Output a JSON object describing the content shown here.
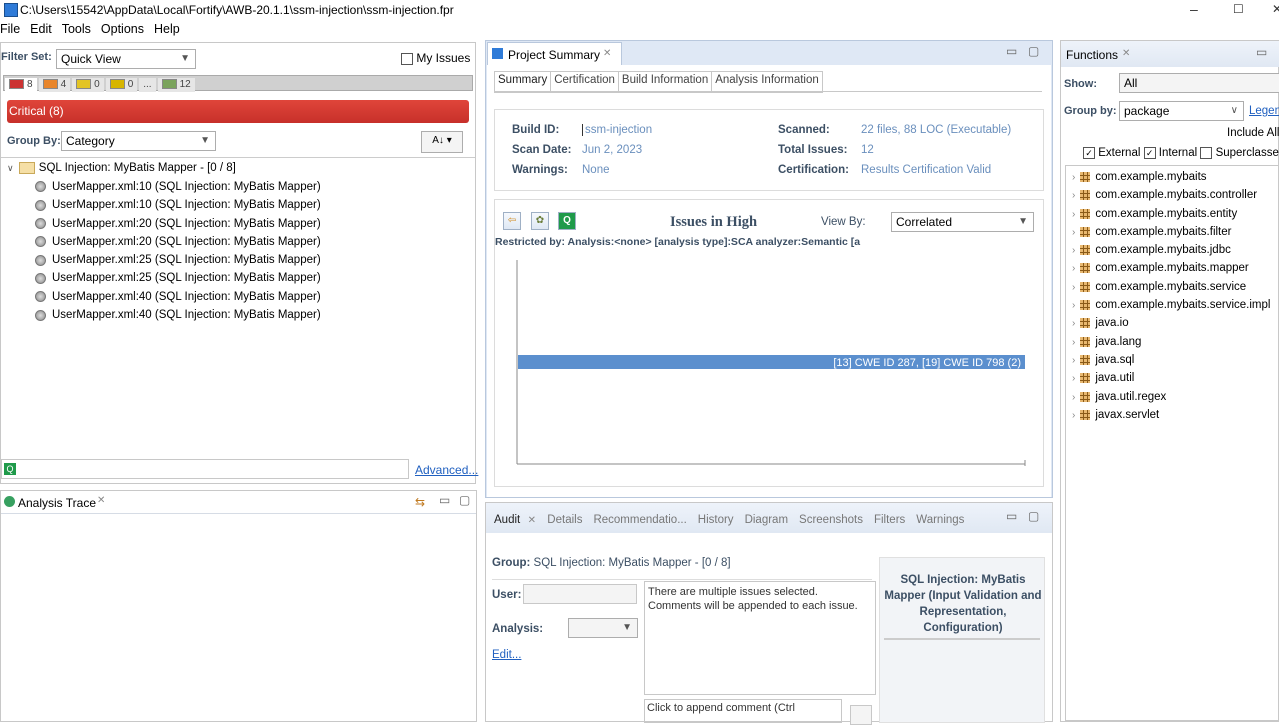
{
  "window": {
    "title": "C:\\Users\\15542\\AppData\\Local\\Fortify\\AWB-20.1.1\\ssm-injection\\ssm-injection.fpr",
    "minimize": "–",
    "maximize": "☐",
    "close": "✕"
  },
  "menu": [
    "File",
    "Edit",
    "Tools",
    "Options",
    "Help"
  ],
  "issues_panel": {
    "filter_set_label": "Filter Set:",
    "filter_set_value": "Quick View",
    "my_issues_label": "My Issues",
    "severity_tabs": [
      {
        "count": "8",
        "color": "#cc3333"
      },
      {
        "count": "4",
        "color": "#e8852a"
      },
      {
        "count": "0",
        "color": "#e3c425"
      },
      {
        "count": "0",
        "color": "#d7b500"
      },
      {
        "count": "...",
        "color": "#bbbbbb"
      },
      {
        "count": "12",
        "color": "#7aa35c"
      }
    ],
    "critical_bar": "Critical (8)",
    "group_by_label": "Group By:",
    "group_by_value": "Category",
    "sort_glyph": "A↓",
    "group_header": "SQL Injection: MyBatis Mapper - [0 / 8]",
    "issues": [
      "UserMapper.xml:10 (SQL Injection: MyBatis Mapper)",
      "UserMapper.xml:10 (SQL Injection: MyBatis Mapper)",
      "UserMapper.xml:20 (SQL Injection: MyBatis Mapper)",
      "UserMapper.xml:20 (SQL Injection: MyBatis Mapper)",
      "UserMapper.xml:25 (SQL Injection: MyBatis Mapper)",
      "UserMapper.xml:25 (SQL Injection: MyBatis Mapper)",
      "UserMapper.xml:40 (SQL Injection: MyBatis Mapper)",
      "UserMapper.xml:40 (SQL Injection: MyBatis Mapper)"
    ],
    "advanced_link": "Advanced..."
  },
  "analysis_trace": {
    "title": "Analysis Trace"
  },
  "project_summary": {
    "tab_title": "Project Summary",
    "subtabs": [
      "Summary",
      "Certification",
      "Build Information",
      "Analysis Information"
    ],
    "build_id_label": "Build ID:",
    "build_id_value": "ssm-injection",
    "scan_date_label": "Scan Date:",
    "scan_date_value": "Jun 2, 2023",
    "warnings_label": "Warnings:",
    "warnings_value": "None",
    "scanned_label": "Scanned:",
    "scanned_value": "22 files, 88 LOC (Executable)",
    "total_issues_label": "Total Issues:",
    "total_issues_value": "12",
    "certification_label": "Certification:",
    "certification_value": "Results Certification Valid",
    "chart_title": "Issues in High",
    "view_by_label": "View By:",
    "view_by_value": "Correlated",
    "restricted_text": "Restricted by: Analysis:<none> [analysis type]:SCA analyzer:Semantic [a"
  },
  "chart_data": {
    "type": "bar",
    "categories": [
      "[13] CWE ID 287, [19] CWE ID 798 (2)"
    ],
    "values": [
      2
    ],
    "orientation": "horizontal",
    "bar_color": "#5b8fce",
    "xlim": [
      0,
      2
    ]
  },
  "audit": {
    "tabs": [
      "Audit",
      "Details",
      "Recommendatio...",
      "History",
      "Diagram",
      "Screenshots",
      "Filters",
      "Warnings"
    ],
    "group_label": "Group:",
    "group_value": "SQL Injection: MyBatis Mapper - [0 / 8]",
    "user_label": "User:",
    "analysis_label": "Analysis:",
    "edit_link": "Edit...",
    "comment_text": "There are multiple issues selected. Comments will be appended to each issue.",
    "append_text": "Click to append comment (Ctrl",
    "category_title": "SQL Injection: MyBatis Mapper (Input Validation and Representation, Configuration)"
  },
  "functions": {
    "title": "Functions",
    "show_label": "Show:",
    "show_value": "All",
    "group_by_label": "Group by:",
    "group_by_value": "package",
    "legend_link": "Legend",
    "include_all": "Include All",
    "external_label": "External",
    "internal_label": "Internal",
    "superclass_label": "Superclasses",
    "packages": [
      "com.example.mybaits",
      "com.example.mybaits.controller",
      "com.example.mybaits.entity",
      "com.example.mybaits.filter",
      "com.example.mybaits.jdbc",
      "com.example.mybaits.mapper",
      "com.example.mybaits.service",
      "com.example.mybaits.service.impl",
      "java.io",
      "java.lang",
      "java.sql",
      "java.util",
      "java.util.regex",
      "javax.servlet"
    ]
  }
}
